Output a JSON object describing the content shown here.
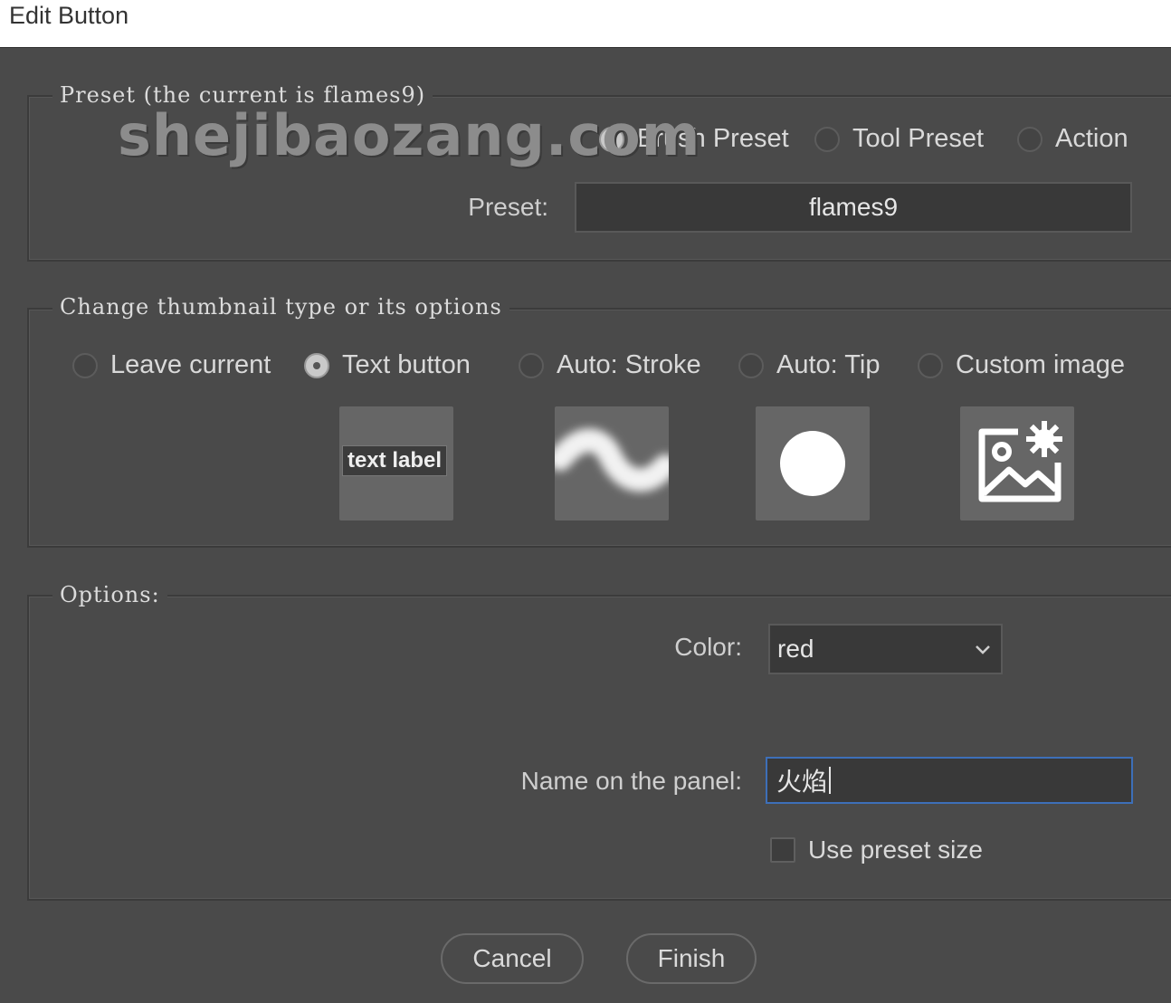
{
  "window": {
    "title": "Edit Button"
  },
  "watermark": "shejibaozang.com",
  "preset_group": {
    "legend": "Preset (the current is flames9)",
    "radios": [
      {
        "label": "Brush Preset",
        "checked": true
      },
      {
        "label": "Tool Preset",
        "checked": false
      },
      {
        "label": "Action",
        "checked": false
      }
    ],
    "preset_label": "Preset:",
    "preset_value": "flames9"
  },
  "thumbnail_group": {
    "legend": "Change thumbnail type or its options",
    "radios": [
      {
        "label": "Leave current",
        "checked": false
      },
      {
        "label": "Text button",
        "checked": true
      },
      {
        "label": "Auto: Stroke",
        "checked": false
      },
      {
        "label": "Auto: Tip",
        "checked": false
      },
      {
        "label": "Custom image",
        "checked": false
      }
    ],
    "thumbnails": [
      {
        "icon": "text-label-thumb",
        "text": "text label"
      },
      {
        "icon": "stroke-thumb"
      },
      {
        "icon": "tip-circle-thumb"
      },
      {
        "icon": "custom-image-thumb"
      }
    ]
  },
  "options_group": {
    "legend": "Options:",
    "color_label": "Color:",
    "color_value": "red",
    "name_label": "Name on the panel:",
    "name_value": "火焰",
    "use_preset_size_label": "Use preset size",
    "use_preset_size_checked": false
  },
  "buttons": {
    "cancel": "Cancel",
    "finish": "Finish"
  },
  "colors": {
    "background": "#4a4a4a",
    "field": "#393939",
    "focus_border": "#3d6fb8"
  }
}
